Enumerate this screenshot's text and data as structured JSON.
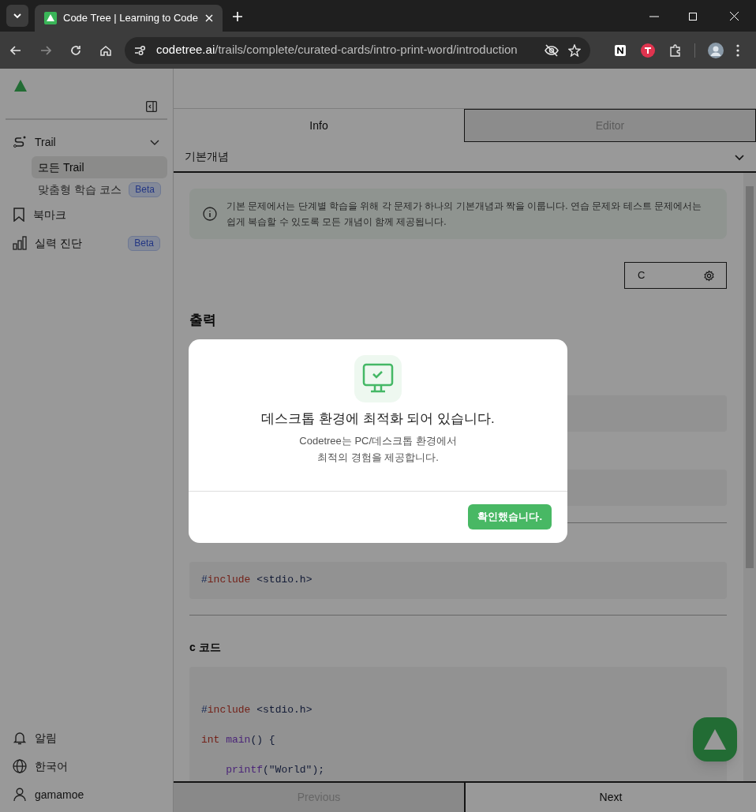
{
  "browser": {
    "tabs": [
      {
        "title": "Code Tree | Learning to Code",
        "selected": true
      }
    ],
    "url": {
      "host": "codetree.ai",
      "path": "/trails/complete/curated-cards/intro-print-word/introduction"
    }
  },
  "sidebar": {
    "nav": [
      {
        "label": "Trail",
        "expanded": true,
        "children": [
          {
            "label": "모든 Trail",
            "selected": true
          },
          {
            "label": "맞춤형 학습 코스",
            "selected": false,
            "badge": "Beta"
          }
        ]
      },
      {
        "label": "북마크"
      },
      {
        "label": "실력 진단",
        "badge": "Beta"
      }
    ],
    "footer": [
      {
        "label": "알림"
      },
      {
        "label": "한국어"
      },
      {
        "label": "gamamoe"
      }
    ]
  },
  "main": {
    "tabs": [
      {
        "label": "Info",
        "selected": true
      },
      {
        "label": "Editor",
        "selected": false
      }
    ],
    "concept": "기본개념",
    "notice": "기본 문제에서는 단계별 학습을 위해 각 문제가 하나의 기본개념과 짝을 이룹니다. 연습 문제와 테스트 문제에서는 쉽게 복습할 수 있도록 모든 개념이 함께 제공됩니다.",
    "language": "C",
    "heading": "출력",
    "include_block": [
      [
        {
          "text": "#",
          "kind": "punct"
        },
        {
          "text": "include",
          "kind": "keyword"
        },
        {
          "text": " <stdio.h>",
          "kind": "plain"
        }
      ]
    ],
    "code_heading": "c 코드",
    "code": [
      [
        {
          "text": "#",
          "kind": "punct"
        },
        {
          "text": "include",
          "kind": "keyword"
        },
        {
          "text": " <stdio.h>",
          "kind": "plain"
        }
      ],
      [
        {
          "text": "int",
          "kind": "keyword"
        },
        {
          "text": " main",
          "kind": "function"
        },
        {
          "text": "() {",
          "kind": "plain"
        }
      ],
      [
        {
          "text": "    printf",
          "kind": "function"
        },
        {
          "text": "(\"World\");",
          "kind": "plain"
        }
      ]
    ],
    "nav": [
      {
        "label": "Previous",
        "disabled": true
      },
      {
        "label": "Next",
        "disabled": false
      }
    ]
  },
  "modal": {
    "title": "데스크톱 환경에 최적화 되어 있습니다.",
    "message": "Codetree는 PC/데스크톱 환경에서\n최적의 경험을 제공합니다.",
    "button": "확인했습니다."
  }
}
